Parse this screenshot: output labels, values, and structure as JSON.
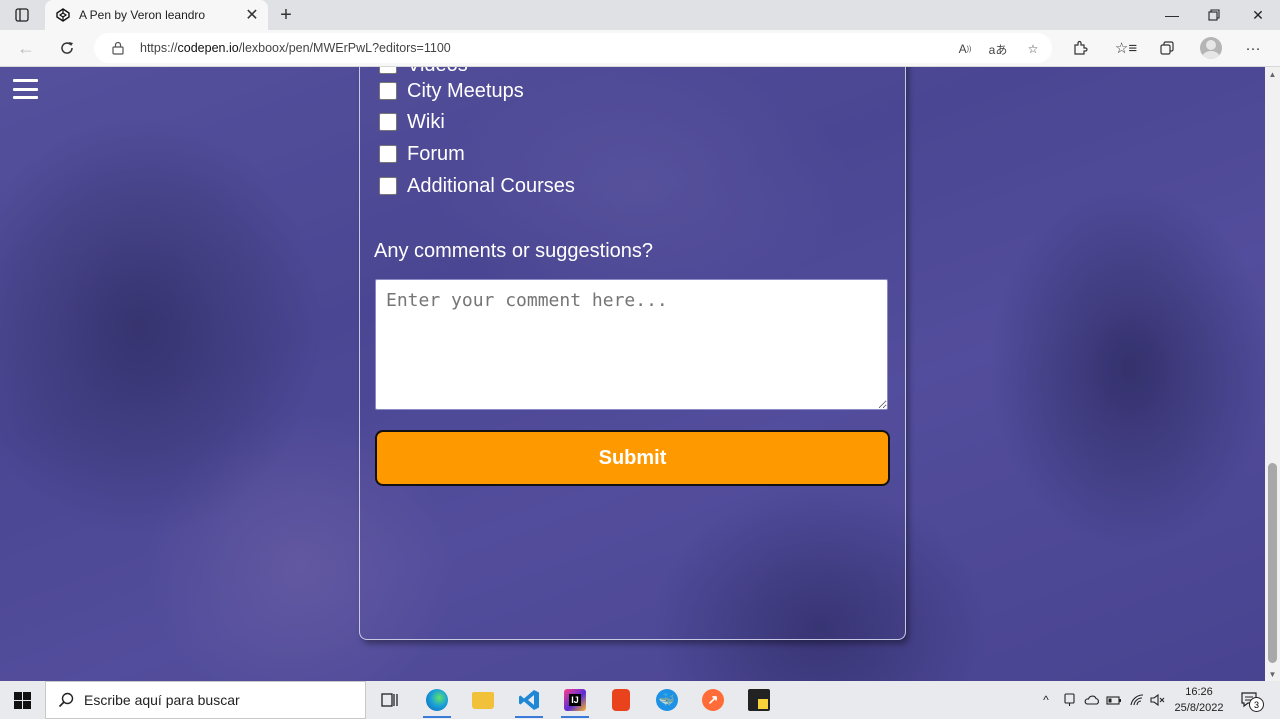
{
  "browser": {
    "tab_title": "A Pen by Veron leandro",
    "url_prefix": "https://",
    "url_host": "codepen.io",
    "url_path": "/lexboox/pen/MWErPwL?editors=1100"
  },
  "page": {
    "checkboxes": [
      {
        "label": "Videos",
        "checked": false
      },
      {
        "label": "City Meetups",
        "checked": false
      },
      {
        "label": "Wiki",
        "checked": false
      },
      {
        "label": "Forum",
        "checked": false
      },
      {
        "label": "Additional Courses",
        "checked": false
      }
    ],
    "comments_question": "Any comments or suggestions?",
    "comment_placeholder": "Enter your comment here...",
    "submit_label": "Submit",
    "submit_color": "#ff9900",
    "overlay_color": "#4e4b8c"
  },
  "taskbar": {
    "search_placeholder": "Escribe aquí para buscar",
    "time": "16:26",
    "date": "25/8/2022",
    "notification_count": "3",
    "apps": [
      "task-view-icon",
      "edge-icon",
      "file-explorer-icon",
      "vscode-icon",
      "intellij-icon",
      "office-icon",
      "docker-icon",
      "postman-icon",
      "sticky-notes-icon"
    ]
  }
}
